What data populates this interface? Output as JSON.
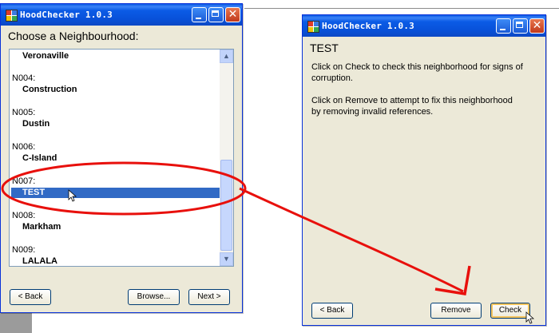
{
  "left_window": {
    "title": "HoodChecker 1.0.3",
    "heading": "Choose a Neighbourhood:",
    "list": {
      "first_name": "Veronaville",
      "items": [
        {
          "code": "N004:",
          "name": "Construction"
        },
        {
          "code": "N005:",
          "name": "Dustin"
        },
        {
          "code": "N006:",
          "name": "C-Island"
        },
        {
          "code": "N007:",
          "name": "TEST"
        },
        {
          "code": "N008:",
          "name": "Markham"
        },
        {
          "code": "N009:",
          "name": "LALALA"
        }
      ],
      "selected_name": "TEST"
    },
    "buttons": {
      "back": "< Back",
      "browse": "Browse...",
      "next": "Next >"
    }
  },
  "right_window": {
    "title": "HoodChecker 1.0.3",
    "heading": "TEST",
    "paragraph1_line1": "Click on Check to check this neighborhood for signs of",
    "paragraph1_line2": "corruption.",
    "paragraph2_line1": "Click on Remove to attempt to fix this neighborhood",
    "paragraph2_line2": "by removing invalid references.",
    "buttons": {
      "back": "< Back",
      "remove": "Remove",
      "check": "Check"
    }
  },
  "colors": {
    "titlebar_blue": "#0851d9",
    "selection_blue": "#316ac5",
    "annotation_red": "#e8100c",
    "window_face": "#ece9d8"
  },
  "icons": [
    "app-icon",
    "minimize-icon",
    "maximize-icon",
    "close-icon",
    "mouse-cursor-icon",
    "scroll-up-icon",
    "scroll-down-icon"
  ]
}
